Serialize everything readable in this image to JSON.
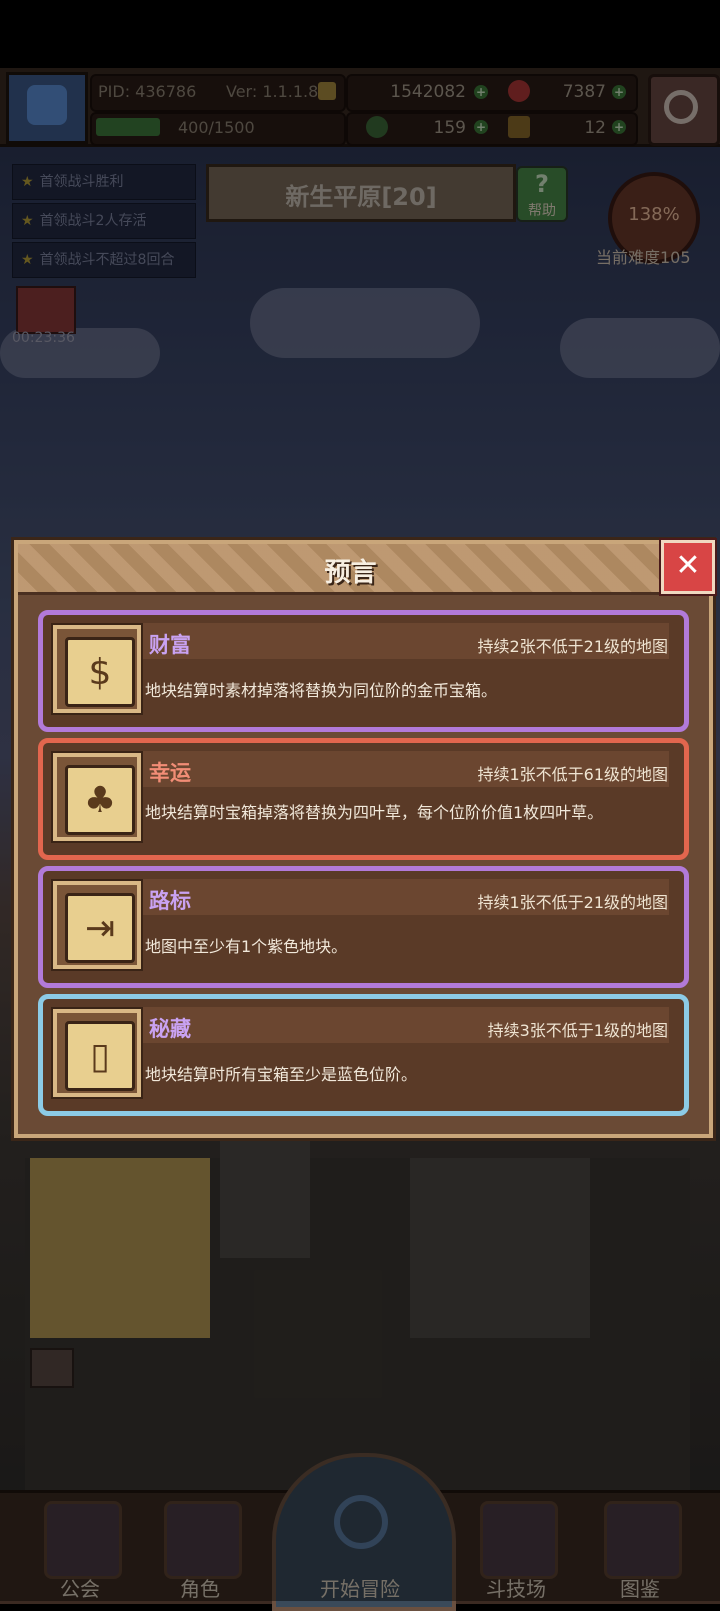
{
  "player": {
    "pid": "PID: 436786",
    "version": "Ver: 1.1.1.8",
    "energy": "400/1500",
    "gold": "1542082",
    "gems": "7387",
    "clover": "159",
    "keys": "12"
  },
  "quests": [
    "首领战斗胜利",
    "首领战斗2人存活",
    "首领战斗不超过8回合"
  ],
  "timer": "00:23:36",
  "map": {
    "name": "新生平原[20]",
    "help_label": "帮助",
    "difficulty_percent": "138%",
    "difficulty_label": "当前难度105"
  },
  "modal": {
    "title": "预言",
    "close_icon": "✕",
    "cards": [
      {
        "name": "财富",
        "duration": "持续2张不低于21级的地图",
        "desc": "地块结算时素材掉落将替换为同位阶的金币宝箱。",
        "icon": "coins-icon",
        "name_color": "#c9a2f2",
        "border_color": "#b27ad9"
      },
      {
        "name": "幸运",
        "duration": "持续1张不低于61级的地图",
        "desc": "地块结算时宝箱掉落将替换为四叶草，每个位阶价值1枚四叶草。",
        "icon": "clover-icon",
        "name_color": "#f28d76",
        "border_color": "#e2664e"
      },
      {
        "name": "路标",
        "duration": "持续1张不低于21级的地图",
        "desc": "地图中至少有1个紫色地块。",
        "icon": "signpost-icon",
        "name_color": "#c9a2f2",
        "border_color": "#b27ad9"
      },
      {
        "name": "秘藏",
        "duration": "持续3张不低于1级的地图",
        "desc": "地块结算时所有宝箱至少是蓝色位阶。",
        "icon": "scroll-icon",
        "name_color": "#c9a2f2",
        "border_color": "#8ccbe6"
      }
    ]
  },
  "nav": [
    "公会",
    "角色",
    "开始冒险",
    "斗技场",
    "图鉴"
  ]
}
